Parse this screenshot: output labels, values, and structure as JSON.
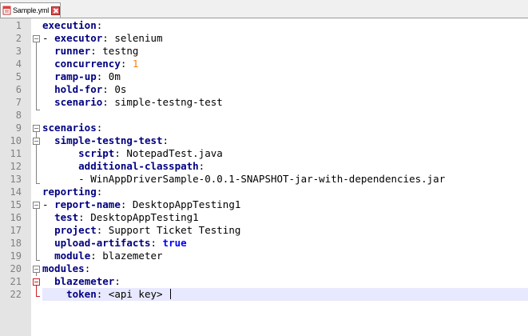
{
  "tab": {
    "label": "Sample.yml",
    "file_icon": "yaml-file-icon",
    "close_icon": "close-icon"
  },
  "editor": {
    "line_numbers": [
      "1",
      "2",
      "3",
      "4",
      "5",
      "6",
      "7",
      "8",
      "9",
      "10",
      "11",
      "12",
      "13",
      "14",
      "15",
      "16",
      "17",
      "18",
      "19",
      "20",
      "21",
      "22"
    ],
    "current_line": 22,
    "lines": [
      [
        {
          "t": "key",
          "v": "execution"
        },
        {
          "t": "val",
          "v": ":"
        }
      ],
      [
        {
          "t": "val",
          "v": "- "
        },
        {
          "t": "key",
          "v": "executor"
        },
        {
          "t": "val",
          "v": ": selenium"
        }
      ],
      [
        {
          "t": "val",
          "v": "  "
        },
        {
          "t": "key",
          "v": "runner"
        },
        {
          "t": "val",
          "v": ": testng"
        }
      ],
      [
        {
          "t": "val",
          "v": "  "
        },
        {
          "t": "key",
          "v": "concurrency"
        },
        {
          "t": "val",
          "v": ": "
        },
        {
          "t": "num",
          "v": "1"
        }
      ],
      [
        {
          "t": "val",
          "v": "  "
        },
        {
          "t": "key",
          "v": "ramp-up"
        },
        {
          "t": "val",
          "v": ": 0m"
        }
      ],
      [
        {
          "t": "val",
          "v": "  "
        },
        {
          "t": "key",
          "v": "hold-for"
        },
        {
          "t": "val",
          "v": ": 0s"
        }
      ],
      [
        {
          "t": "val",
          "v": "  "
        },
        {
          "t": "key",
          "v": "scenario"
        },
        {
          "t": "val",
          "v": ": simple-testng-test"
        }
      ],
      [],
      [
        {
          "t": "key",
          "v": "scenarios"
        },
        {
          "t": "val",
          "v": ":"
        }
      ],
      [
        {
          "t": "val",
          "v": "  "
        },
        {
          "t": "key",
          "v": "simple-testng-test"
        },
        {
          "t": "val",
          "v": ":"
        }
      ],
      [
        {
          "t": "val",
          "v": "      "
        },
        {
          "t": "key",
          "v": "script"
        },
        {
          "t": "val",
          "v": ": NotepadTest.java"
        }
      ],
      [
        {
          "t": "val",
          "v": "      "
        },
        {
          "t": "key",
          "v": "additional-classpath"
        },
        {
          "t": "val",
          "v": ":"
        }
      ],
      [
        {
          "t": "val",
          "v": "      - WinAppDriverSample-0.0.1-SNAPSHOT-jar-with-dependencies.jar"
        }
      ],
      [
        {
          "t": "key",
          "v": "reporting"
        },
        {
          "t": "val",
          "v": ":"
        }
      ],
      [
        {
          "t": "val",
          "v": "- "
        },
        {
          "t": "key",
          "v": "report-name"
        },
        {
          "t": "val",
          "v": ": DesktopAppTesting1"
        }
      ],
      [
        {
          "t": "val",
          "v": "  "
        },
        {
          "t": "key",
          "v": "test"
        },
        {
          "t": "val",
          "v": ": DesktopAppTesting1"
        }
      ],
      [
        {
          "t": "val",
          "v": "  "
        },
        {
          "t": "key",
          "v": "project"
        },
        {
          "t": "val",
          "v": ": Support Ticket Testing"
        }
      ],
      [
        {
          "t": "val",
          "v": "  "
        },
        {
          "t": "key",
          "v": "upload-artifacts"
        },
        {
          "t": "val",
          "v": ": "
        },
        {
          "t": "bool",
          "v": "true"
        }
      ],
      [
        {
          "t": "val",
          "v": "  "
        },
        {
          "t": "key",
          "v": "module"
        },
        {
          "t": "val",
          "v": ": blazemeter"
        }
      ],
      [
        {
          "t": "key",
          "v": "modules"
        },
        {
          "t": "val",
          "v": ":"
        }
      ],
      [
        {
          "t": "val",
          "v": "  "
        },
        {
          "t": "key",
          "v": "blazemeter"
        },
        {
          "t": "val",
          "v": ":"
        }
      ],
      [
        {
          "t": "val",
          "v": "    "
        },
        {
          "t": "key",
          "v": "token"
        },
        {
          "t": "val",
          "v": ": <api key> "
        }
      ]
    ]
  },
  "colors": {
    "key": "#000080",
    "number": "#ff8000",
    "boolean": "#0000ff",
    "current_line_bg": "#e8e8ff",
    "fold_active": "#d02020"
  }
}
